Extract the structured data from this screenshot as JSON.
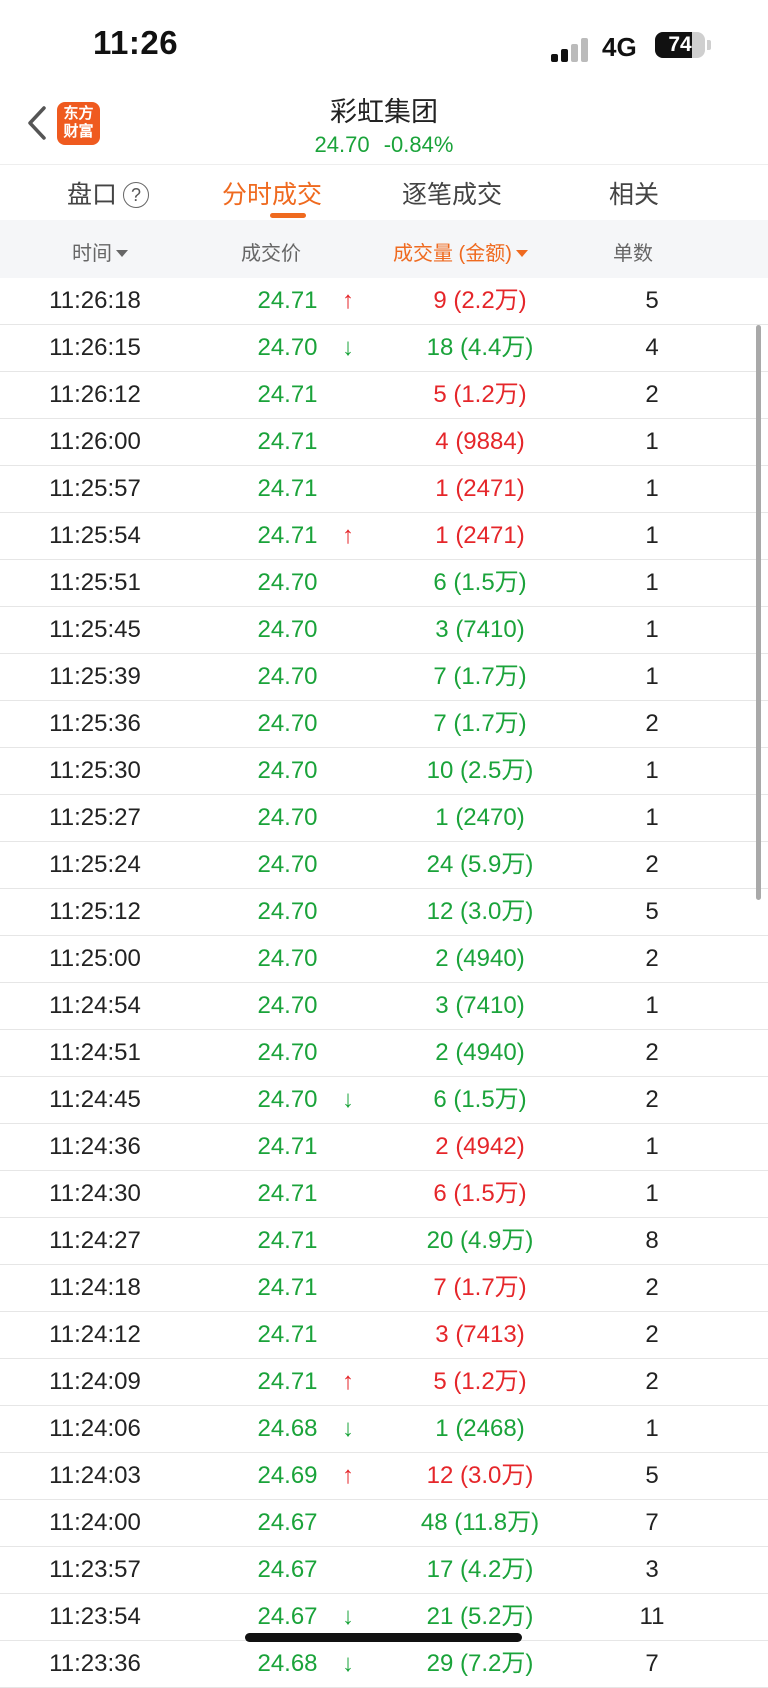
{
  "status_bar": {
    "time": "11:26",
    "network": "4G",
    "battery": "74",
    "battery_level": 0.74
  },
  "header": {
    "title": "彩虹集团",
    "price": "24.70",
    "change": "-0.84%",
    "logo_line1": "东方",
    "logo_line2": "财富"
  },
  "tabs": [
    {
      "label": "盘口",
      "help": "?"
    },
    {
      "label": "分时成交",
      "active": true
    },
    {
      "label": "逐笔成交"
    },
    {
      "label": "相关"
    }
  ],
  "columns": {
    "time": "时间",
    "price": "成交价",
    "volume": "成交量 (金额)",
    "count": "单数"
  },
  "colors": {
    "up": "#e5262a",
    "down": "#1aa33a",
    "accent": "#ef6a1f"
  },
  "rows": [
    {
      "time": "11:26:18",
      "price": "24.71",
      "arrow": "↑",
      "volume": "9 (2.2万)",
      "count": "5",
      "pc": "green",
      "vc": "red"
    },
    {
      "time": "11:26:15",
      "price": "24.70",
      "arrow": "↓",
      "volume": "18 (4.4万)",
      "count": "4",
      "pc": "green",
      "vc": "green"
    },
    {
      "time": "11:26:12",
      "price": "24.71",
      "arrow": "",
      "volume": "5 (1.2万)",
      "count": "2",
      "pc": "green",
      "vc": "red"
    },
    {
      "time": "11:26:00",
      "price": "24.71",
      "arrow": "",
      "volume": "4 (9884)",
      "count": "1",
      "pc": "green",
      "vc": "red"
    },
    {
      "time": "11:25:57",
      "price": "24.71",
      "arrow": "",
      "volume": "1 (2471)",
      "count": "1",
      "pc": "green",
      "vc": "red"
    },
    {
      "time": "11:25:54",
      "price": "24.71",
      "arrow": "↑",
      "volume": "1 (2471)",
      "count": "1",
      "pc": "green",
      "vc": "red"
    },
    {
      "time": "11:25:51",
      "price": "24.70",
      "arrow": "",
      "volume": "6 (1.5万)",
      "count": "1",
      "pc": "green",
      "vc": "green"
    },
    {
      "time": "11:25:45",
      "price": "24.70",
      "arrow": "",
      "volume": "3 (7410)",
      "count": "1",
      "pc": "green",
      "vc": "green"
    },
    {
      "time": "11:25:39",
      "price": "24.70",
      "arrow": "",
      "volume": "7 (1.7万)",
      "count": "1",
      "pc": "green",
      "vc": "green"
    },
    {
      "time": "11:25:36",
      "price": "24.70",
      "arrow": "",
      "volume": "7 (1.7万)",
      "count": "2",
      "pc": "green",
      "vc": "green"
    },
    {
      "time": "11:25:30",
      "price": "24.70",
      "arrow": "",
      "volume": "10 (2.5万)",
      "count": "1",
      "pc": "green",
      "vc": "green"
    },
    {
      "time": "11:25:27",
      "price": "24.70",
      "arrow": "",
      "volume": "1 (2470)",
      "count": "1",
      "pc": "green",
      "vc": "green"
    },
    {
      "time": "11:25:24",
      "price": "24.70",
      "arrow": "",
      "volume": "24 (5.9万)",
      "count": "2",
      "pc": "green",
      "vc": "green"
    },
    {
      "time": "11:25:12",
      "price": "24.70",
      "arrow": "",
      "volume": "12 (3.0万)",
      "count": "5",
      "pc": "green",
      "vc": "green"
    },
    {
      "time": "11:25:00",
      "price": "24.70",
      "arrow": "",
      "volume": "2 (4940)",
      "count": "2",
      "pc": "green",
      "vc": "green"
    },
    {
      "time": "11:24:54",
      "price": "24.70",
      "arrow": "",
      "volume": "3 (7410)",
      "count": "1",
      "pc": "green",
      "vc": "green"
    },
    {
      "time": "11:24:51",
      "price": "24.70",
      "arrow": "",
      "volume": "2 (4940)",
      "count": "2",
      "pc": "green",
      "vc": "green"
    },
    {
      "time": "11:24:45",
      "price": "24.70",
      "arrow": "↓",
      "volume": "6 (1.5万)",
      "count": "2",
      "pc": "green",
      "vc": "green"
    },
    {
      "time": "11:24:36",
      "price": "24.71",
      "arrow": "",
      "volume": "2 (4942)",
      "count": "1",
      "pc": "green",
      "vc": "red"
    },
    {
      "time": "11:24:30",
      "price": "24.71",
      "arrow": "",
      "volume": "6 (1.5万)",
      "count": "1",
      "pc": "green",
      "vc": "red"
    },
    {
      "time": "11:24:27",
      "price": "24.71",
      "arrow": "",
      "volume": "20 (4.9万)",
      "count": "8",
      "pc": "green",
      "vc": "green"
    },
    {
      "time": "11:24:18",
      "price": "24.71",
      "arrow": "",
      "volume": "7 (1.7万)",
      "count": "2",
      "pc": "green",
      "vc": "red"
    },
    {
      "time": "11:24:12",
      "price": "24.71",
      "arrow": "",
      "volume": "3 (7413)",
      "count": "2",
      "pc": "green",
      "vc": "red"
    },
    {
      "time": "11:24:09",
      "price": "24.71",
      "arrow": "↑",
      "volume": "5 (1.2万)",
      "count": "2",
      "pc": "green",
      "vc": "red"
    },
    {
      "time": "11:24:06",
      "price": "24.68",
      "arrow": "↓",
      "volume": "1 (2468)",
      "count": "1",
      "pc": "green",
      "vc": "green"
    },
    {
      "time": "11:24:03",
      "price": "24.69",
      "arrow": "↑",
      "volume": "12 (3.0万)",
      "count": "5",
      "pc": "green",
      "vc": "red"
    },
    {
      "time": "11:24:00",
      "price": "24.67",
      "arrow": "",
      "volume": "48 (11.8万)",
      "count": "7",
      "pc": "green",
      "vc": "green"
    },
    {
      "time": "11:23:57",
      "price": "24.67",
      "arrow": "",
      "volume": "17 (4.2万)",
      "count": "3",
      "pc": "green",
      "vc": "green"
    },
    {
      "time": "11:23:54",
      "price": "24.67",
      "arrow": "↓",
      "volume": "21 (5.2万)",
      "count": "11",
      "pc": "green",
      "vc": "green"
    },
    {
      "time": "11:23:36",
      "price": "24.68",
      "arrow": "↓",
      "volume": "29 (7.2万)",
      "count": "7",
      "pc": "green",
      "vc": "green"
    }
  ]
}
